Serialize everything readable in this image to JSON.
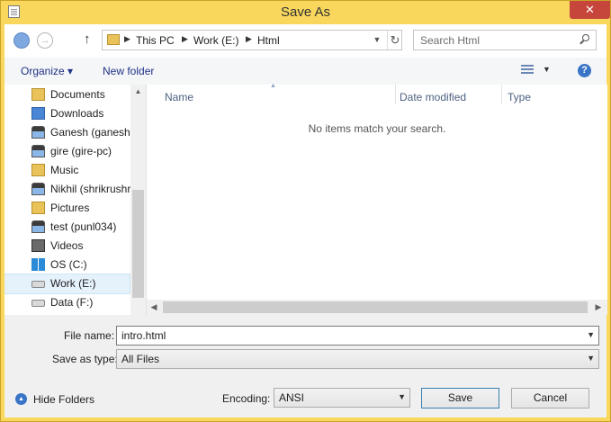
{
  "window": {
    "title": "Save As",
    "close_label": "✕"
  },
  "address_bar": {
    "crumbs": [
      "This PC",
      "Work (E:)",
      "Html"
    ],
    "search_placeholder": "Search Html"
  },
  "toolbar": {
    "organize_label": "Organize ▾",
    "new_folder_label": "New folder",
    "help_label": "?"
  },
  "nav_pane": {
    "items": [
      {
        "label": "Documents",
        "icon": "documents-folder-icon"
      },
      {
        "label": "Downloads",
        "icon": "downloads-folder-icon"
      },
      {
        "label": "Ganesh (ganesh-",
        "icon": "network-user-icon"
      },
      {
        "label": "gire (gire-pc)",
        "icon": "network-user-icon"
      },
      {
        "label": "Music",
        "icon": "music-folder-icon"
      },
      {
        "label": "Nikhil (shrikrushr",
        "icon": "network-user-icon"
      },
      {
        "label": "Pictures",
        "icon": "pictures-folder-icon"
      },
      {
        "label": "test (punl034)",
        "icon": "network-user-icon"
      },
      {
        "label": "Videos",
        "icon": "videos-folder-icon"
      },
      {
        "label": "OS (C:)",
        "icon": "windows-drive-icon"
      },
      {
        "label": "Work (E:)",
        "icon": "drive-icon",
        "selected": true
      },
      {
        "label": "Data (F:)",
        "icon": "drive-icon"
      }
    ]
  },
  "file_list": {
    "columns": [
      "Name",
      "Date modified",
      "Type"
    ],
    "empty_message": "No items match your search."
  },
  "form": {
    "file_name_label": "File name:",
    "file_name_value": "intro.html",
    "save_as_type_label": "Save as type:",
    "save_as_type_value": "All Files",
    "encoding_label": "Encoding:",
    "encoding_value": "ANSI"
  },
  "footer": {
    "hide_folders_label": "Hide Folders",
    "save_label": "Save",
    "cancel_label": "Cancel"
  },
  "colors": {
    "frame": "#f8d75c",
    "close_button": "#c7463b",
    "link_text": "#1e3287",
    "selected_row": "#e5f1fb"
  }
}
